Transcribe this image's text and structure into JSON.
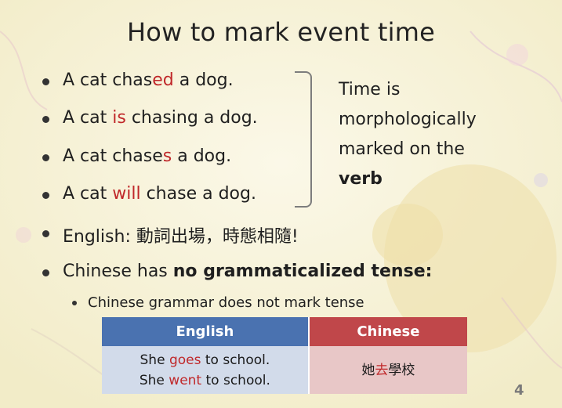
{
  "slide": {
    "title": "How to mark event time",
    "bullets": [
      {
        "pre": "A cat chas",
        "hl": "ed",
        "post": " a dog."
      },
      {
        "pre": "A cat ",
        "hl": "is",
        "post": " chasing a dog."
      },
      {
        "pre": "A cat chase",
        "hl": "s",
        "post": " a dog."
      },
      {
        "pre": "A cat ",
        "hl": "will",
        "post": " chase a dog."
      }
    ],
    "english_bullet": "English: 動詞出場，時態相隨!",
    "chinese_bullet": {
      "pre": "Chinese has ",
      "bold": "no grammaticalized tense:"
    },
    "sub_bullet": "Chinese grammar does not mark tense",
    "note": {
      "line1": "Time is",
      "line2": "morphologically",
      "line3": "marked on the",
      "line4": "verb"
    },
    "table": {
      "headers": {
        "english": "English",
        "chinese": "Chinese"
      },
      "english_rows": [
        {
          "pre": "She ",
          "hl": "goes",
          "post": " to school."
        },
        {
          "pre": "She ",
          "hl": "went",
          "post": " to school."
        }
      ],
      "chinese": {
        "pre": "她",
        "hl": "去",
        "post": "學校"
      }
    },
    "page_number": "4"
  },
  "colors": {
    "highlight": "#c0282a",
    "header_english": "#4a72b0",
    "header_chinese": "#c0474a",
    "cell_english": "#d2dbea",
    "cell_chinese": "#e8c7c7",
    "background": "#f7f2d9"
  }
}
